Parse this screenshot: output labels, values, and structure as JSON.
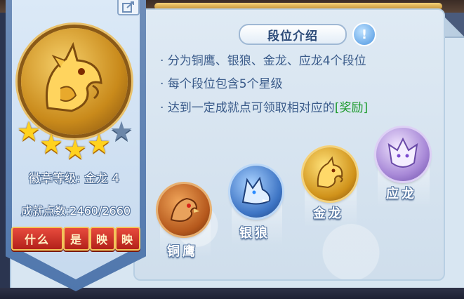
{
  "panel": {
    "title": "段位介绍",
    "info_glyph": "!",
    "edit_icon": "edit-icon",
    "descriptions": [
      {
        "bullet": "·",
        "text": "分为铜鹰、银狼、金龙、应龙4个段位",
        "highlight": ""
      },
      {
        "bullet": "·",
        "text": "每个段位包含5个星级",
        "highlight": ""
      },
      {
        "bullet": "·",
        "text": "达到一定成就点可领取相对应的",
        "highlight": "[奖励]"
      }
    ]
  },
  "badge": {
    "icon": "golden-dragon-icon",
    "level_label": "徽章等级: 金龙 4",
    "points_label": "成就点数:2460/2660",
    "stars_filled": 4,
    "stars_total": 5,
    "tags": [
      "什么",
      "是",
      "映",
      "映"
    ]
  },
  "ranks": [
    {
      "name": "铜鹰",
      "icon": "bronze-eagle-icon",
      "color": "#c8762f"
    },
    {
      "name": "银狼",
      "icon": "silver-wolf-icon",
      "color": "#4f8ad0"
    },
    {
      "name": "金龙",
      "icon": "gold-dragon-icon",
      "color": "#e0a21e"
    },
    {
      "name": "应龙",
      "icon": "purple-dragon-icon",
      "color": "#a88ad8"
    }
  ],
  "colors": {
    "accent": "#3a5b8a",
    "highlight": "#1a9a2a",
    "tag_red": "#d0362b"
  }
}
